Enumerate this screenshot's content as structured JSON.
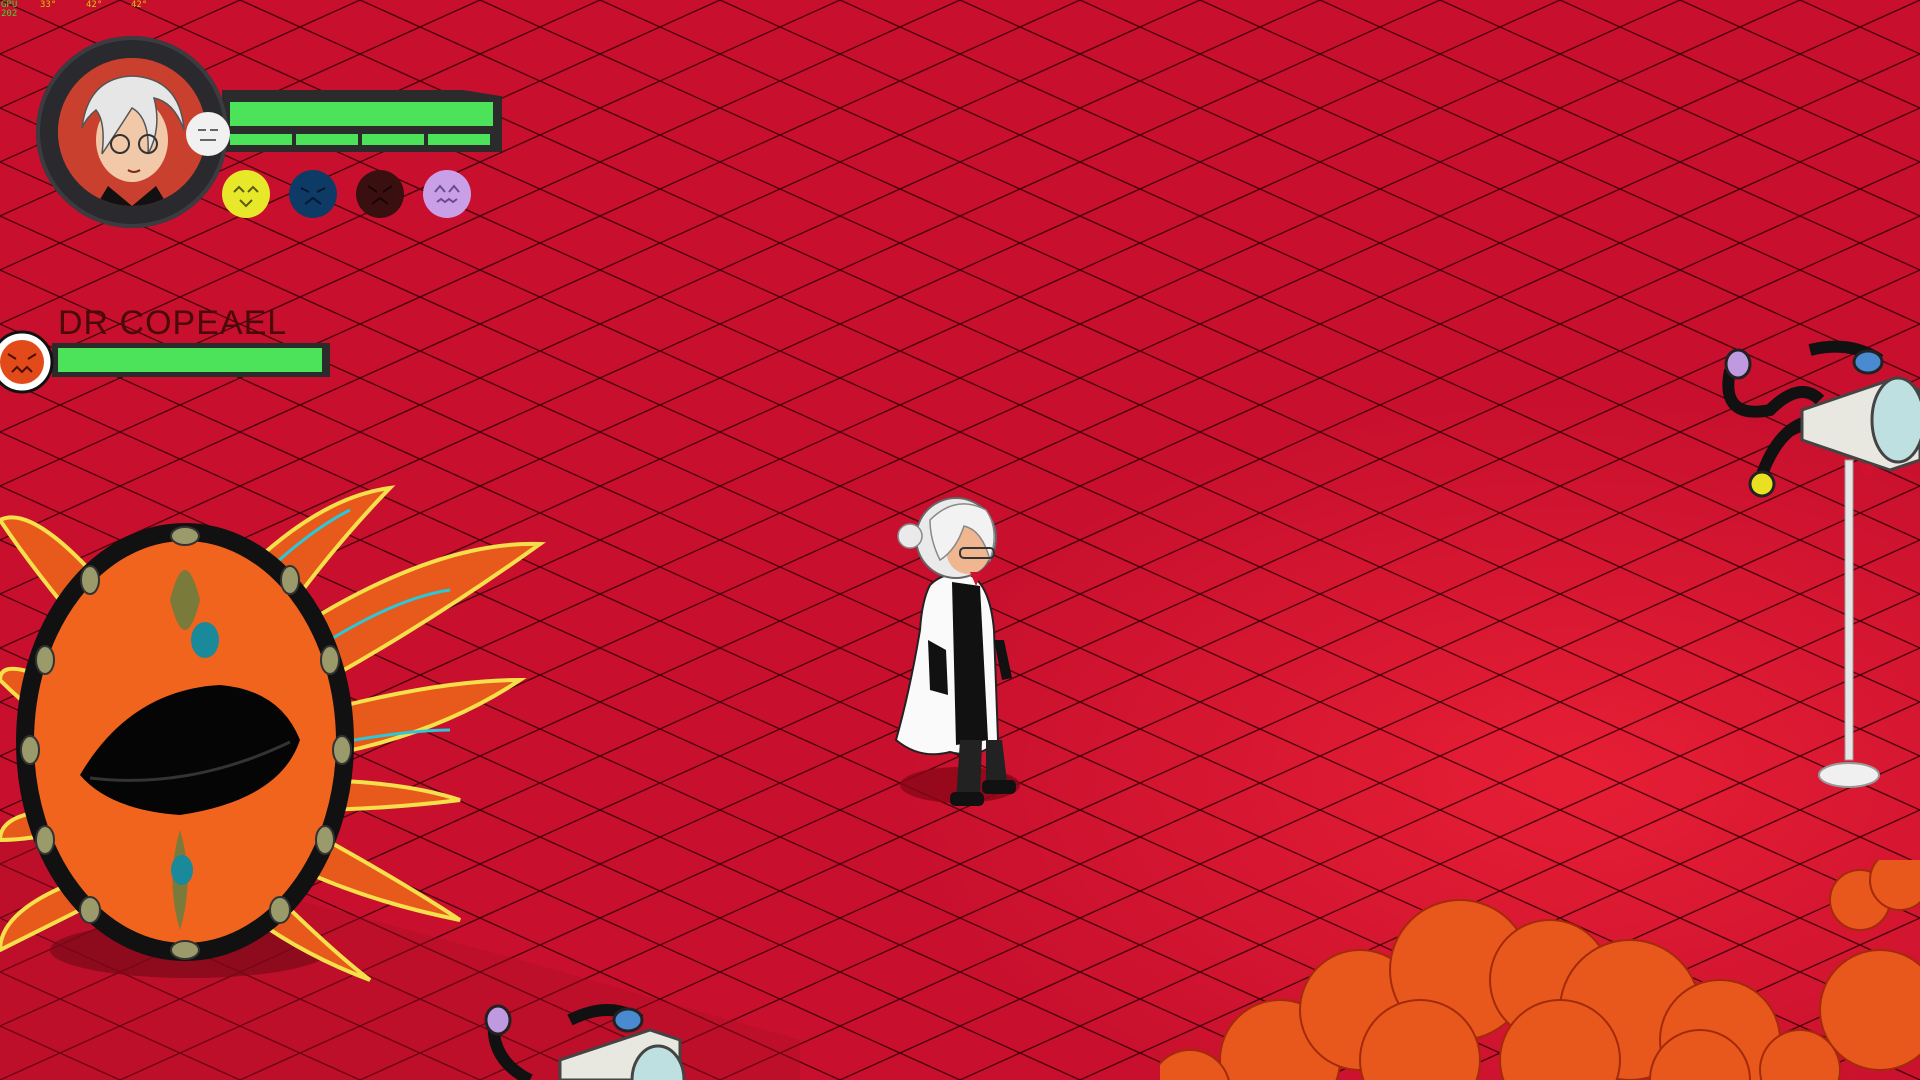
{
  "perf_overlay": {
    "label": "GPU",
    "value": "202",
    "temps": [
      "33°",
      "42°",
      "42°"
    ]
  },
  "player": {
    "portrait_icon": "silver-haired-scientist-portrait",
    "hp_fraction": 1.0,
    "stamina_segments": 4,
    "mood_icon": "neutral-face-icon",
    "emotions": [
      {
        "name": "happy",
        "icon": "happy-face-icon",
        "color": "#e8e82a"
      },
      {
        "name": "sad",
        "icon": "sad-face-icon",
        "color": "#0e3a66"
      },
      {
        "name": "angry",
        "icon": "angry-face-icon",
        "color": "#3a0f10"
      },
      {
        "name": "afraid",
        "icon": "afraid-face-icon",
        "color": "#c9a0e8"
      }
    ]
  },
  "boss": {
    "name": "DR COPEAEL",
    "hp_fraction": 1.0,
    "mood_icon": "angry-face-icon",
    "mood_color": "#e24a1a"
  },
  "colors": {
    "floor": "#c8102e",
    "grid_line": "#3a0008",
    "hp_bar": "#4ce35a",
    "bar_frame": "#2b2b2b"
  }
}
